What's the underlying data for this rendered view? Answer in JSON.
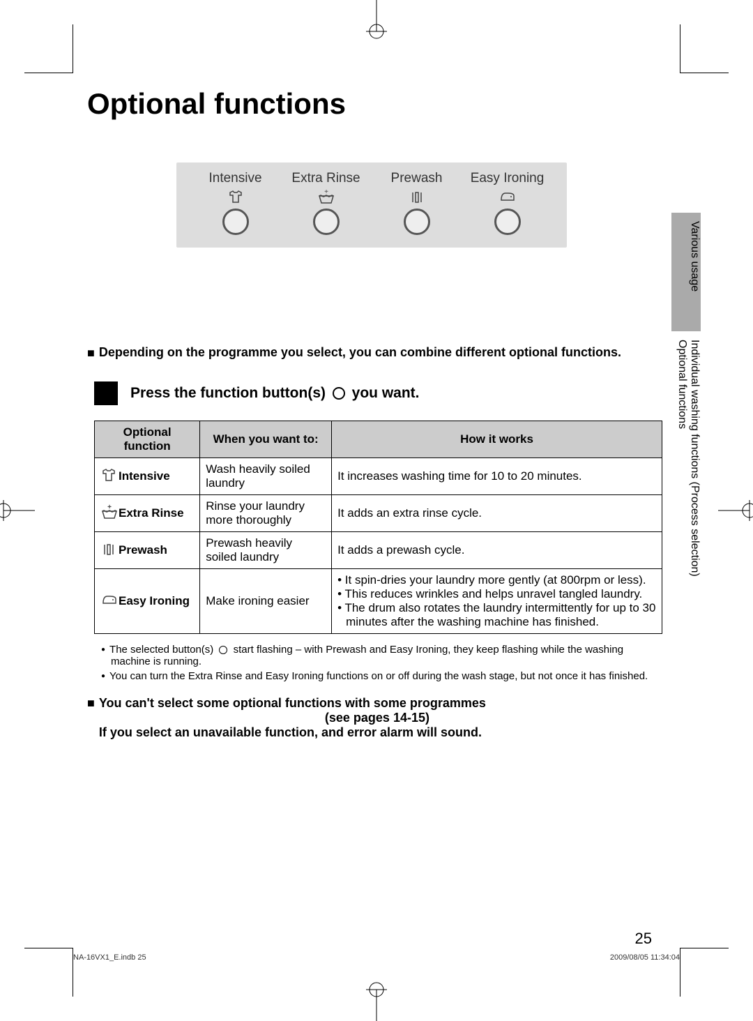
{
  "title": "Optional functions",
  "sideTab": {
    "gray": "Various usage",
    "white1": "Individual washing functions (Process selection)",
    "white2": "Optional functions"
  },
  "panel": {
    "buttons": [
      {
        "label": "Intensive",
        "icon": "shirt-icon"
      },
      {
        "label": "Extra Rinse",
        "icon": "basin-plus-icon"
      },
      {
        "label": "Prewash",
        "icon": "prewash-icon"
      },
      {
        "label": "Easy Ironing",
        "icon": "iron-icon"
      }
    ]
  },
  "intro": "Depending on the programme you select, you can combine different optional functions.",
  "step": {
    "before": "Press the function button(s) ",
    "after": " you want."
  },
  "table": {
    "headers": [
      "Optional function",
      "When you want to:",
      "How it works"
    ],
    "rows": [
      {
        "icon": "shirt-icon",
        "name": "Intensive",
        "when": "Wash heavily soiled laundry",
        "how": "It increases washing time for 10 to 20 minutes."
      },
      {
        "icon": "basin-plus-icon",
        "name": "Extra Rinse",
        "when": "Rinse your laundry more thoroughly",
        "how": "It adds an extra rinse cycle."
      },
      {
        "icon": "prewash-icon",
        "name": "Prewash",
        "when": "Prewash heavily soiled laundry",
        "how": "It adds a prewash cycle."
      },
      {
        "icon": "iron-icon",
        "name": "Easy Ironing",
        "when": "Make ironing easier",
        "how_list": [
          "It spin-dries your laundry more gently (at 800rpm or less).",
          "This reduces wrinkles and helps unravel tangled laundry.",
          "The drum also rotates the laundry intermittently for up to 30 minutes after the washing machine has finished."
        ]
      }
    ]
  },
  "notes": [
    "The selected button(s) ○ start flashing – with Prewash and Easy Ironing, they keep flashing while the washing machine is running.",
    "You can turn the Extra Rinse and Easy Ironing functions on or off during the wash stage, but not once it has finished."
  ],
  "warning": {
    "line1": "You can't select some optional functions with some programmes",
    "line2": "(see pages 14-15)",
    "line3": "If you select an unavailable function, and error alarm will sound."
  },
  "pageNumber": "25",
  "footer": {
    "left": "NA-16VX1_E.indb   25",
    "right": "2009/08/05   11:34:04"
  }
}
